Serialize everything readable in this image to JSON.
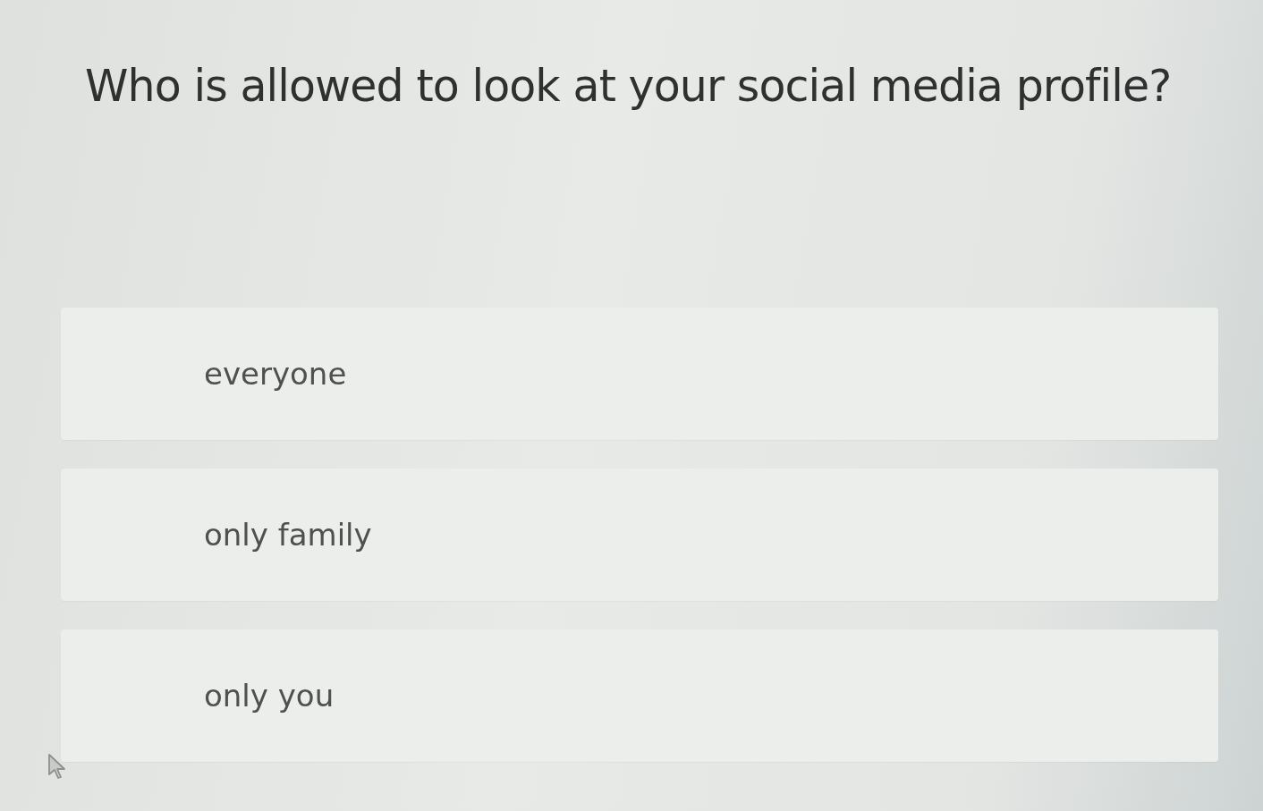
{
  "question": "Who is allowed to look at your social media profile?",
  "options": [
    {
      "label": "everyone",
      "selected": false
    },
    {
      "label": "only family",
      "selected": false
    },
    {
      "label": "only you",
      "selected": false
    }
  ]
}
